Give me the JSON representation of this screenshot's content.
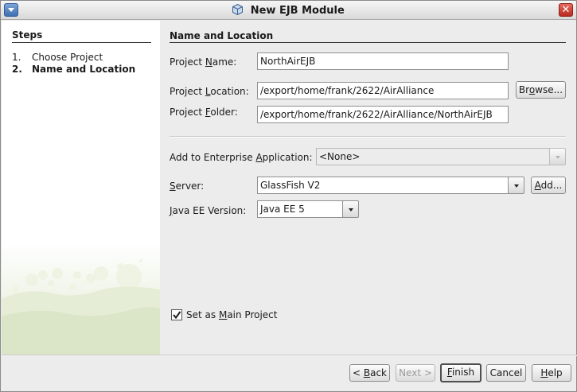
{
  "window": {
    "title": "New EJB Module"
  },
  "steps": {
    "heading": "Steps",
    "items": [
      {
        "num": "1.",
        "label": "Choose Project",
        "current": false
      },
      {
        "num": "2.",
        "label": "Name and Location",
        "current": true
      }
    ]
  },
  "panel": {
    "heading": "Name and Location",
    "project_name": {
      "label_pre": "Project ",
      "label_mnemonic": "N",
      "label_post": "ame:",
      "value": "NorthAirEJB"
    },
    "project_location": {
      "label_pre": "Project ",
      "label_mnemonic": "L",
      "label_post": "ocation:",
      "value": "/export/home/frank/2622/AirAlliance"
    },
    "browse": {
      "pre": "Br",
      "mnemonic": "o",
      "post": "wse..."
    },
    "project_folder": {
      "label_pre": "Project ",
      "label_mnemonic": "F",
      "label_post": "older:",
      "value": "/export/home/frank/2622/AirAlliance/NorthAirEJB"
    },
    "enterprise_app": {
      "label_pre": "Add to Enterprise ",
      "label_mnemonic": "A",
      "label_post": "pplication:",
      "value": "<None>"
    },
    "server": {
      "label_pre": "",
      "label_mnemonic": "S",
      "label_post": "erver:",
      "value": "GlassFish V2"
    },
    "add": {
      "pre": "",
      "mnemonic": "A",
      "post": "dd..."
    },
    "java_ee": {
      "label_pre": "",
      "label_mnemonic": "J",
      "label_post": "ava EE Version:",
      "value": "Java EE 5"
    },
    "main_project": {
      "label_pre": "Set as ",
      "label_mnemonic": "M",
      "label_post": "ain Project",
      "checked": true
    }
  },
  "buttons": {
    "back": {
      "pre": "< ",
      "mnemonic": "B",
      "post": "ack"
    },
    "next": {
      "label": "Next >"
    },
    "finish": {
      "pre": "",
      "mnemonic": "F",
      "post": "inish"
    },
    "cancel": {
      "label": "Cancel"
    },
    "help": {
      "pre": "",
      "mnemonic": "H",
      "post": "elp"
    }
  }
}
